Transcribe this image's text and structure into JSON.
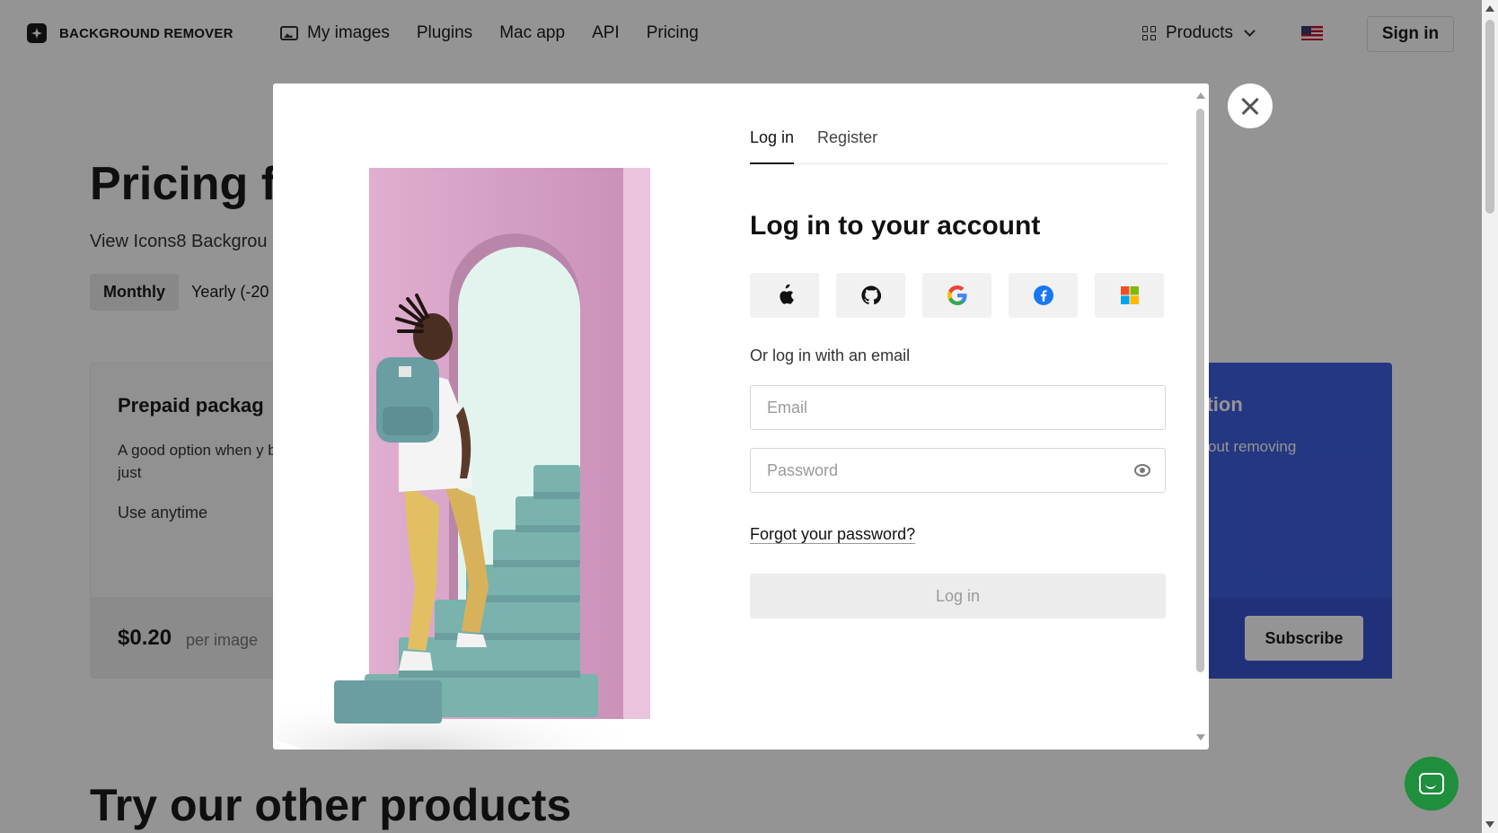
{
  "header": {
    "brand": "BACKGROUND REMOVER",
    "nav": [
      "My images",
      "Plugins",
      "Mac app",
      "API",
      "Pricing"
    ],
    "products": "Products",
    "sign_in": "Sign in"
  },
  "hero": {
    "title": "Pricing f",
    "subtitle": "View Icons8 Backgrou",
    "billing": {
      "monthly": "Monthly",
      "yearly": "Yearly (-20"
    }
  },
  "card_left": {
    "title": "Prepaid packag",
    "description": "A good option when y background from just",
    "note": "Use anytime",
    "price": "$0.20",
    "unit": "per image"
  },
  "card_right": {
    "title": "otion",
    "description": "out removing",
    "button": "Subscribe"
  },
  "section_title": "Try our other products",
  "modal": {
    "tabs": [
      "Log in",
      "Register"
    ],
    "active_tab": "Log in",
    "title": "Log in to your account",
    "social": [
      "apple-icon",
      "github-icon",
      "google-icon",
      "facebook-icon",
      "microsoft-icon"
    ],
    "or_text": "Or log in with an email",
    "email_placeholder": "Email",
    "password_placeholder": "Password",
    "forgot": "Forgot your password?",
    "submit": "Log in"
  },
  "colors": {
    "accent_blue": "#3f5fe0",
    "chat_green": "#1f8e3d",
    "arch_pink": "#d9a3c5",
    "stairs_teal": "#6e9ea3"
  }
}
